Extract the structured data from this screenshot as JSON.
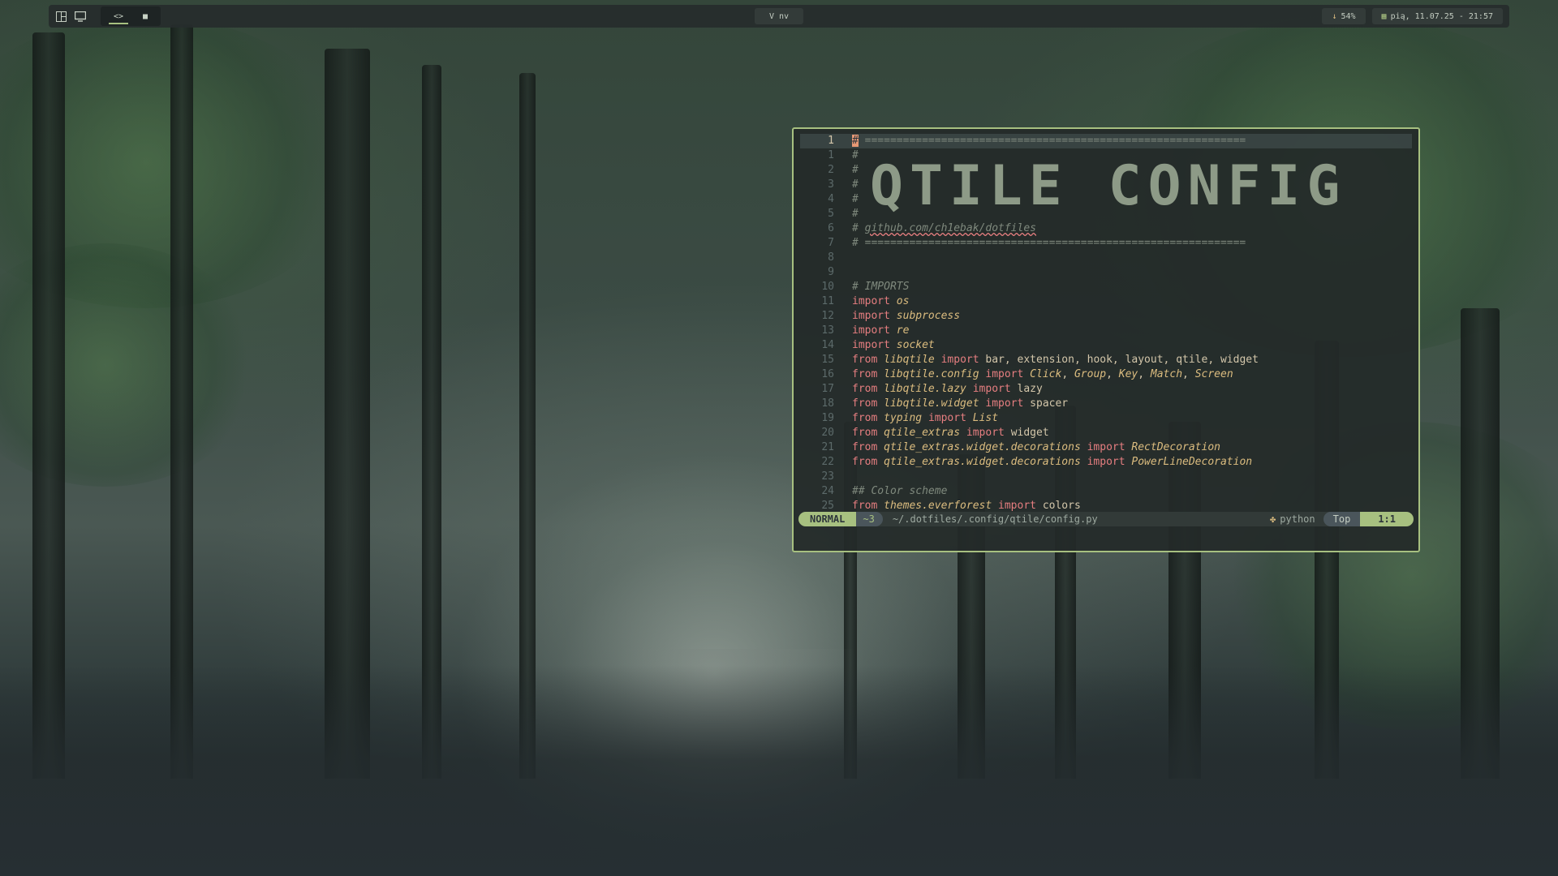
{
  "topbar": {
    "left_icons": [
      "layout-icon",
      "monitor-icon"
    ],
    "workspaces": [
      {
        "label": "<>",
        "icon": "code-icon",
        "active": true
      },
      {
        "label": "■",
        "icon": "camera-icon",
        "active": false
      }
    ],
    "window_name": "V nv",
    "battery": {
      "icon": "arrow-down-icon",
      "value": "54%"
    },
    "clock": {
      "icon": "calendar-icon",
      "value": "pią, 11.07.25 - 21:57"
    }
  },
  "editor": {
    "lines": [
      {
        "n": "1",
        "cur": true,
        "text": "# ============================================================"
      },
      {
        "n": "1",
        "text": "#"
      },
      {
        "n": "2",
        "text": "#"
      },
      {
        "n": "3",
        "text": "#"
      },
      {
        "n": "4",
        "text": "#"
      },
      {
        "n": "5",
        "text": "#"
      },
      {
        "n": "6",
        "text": "# github.com/ch1ebak/dotfiles"
      },
      {
        "n": "7",
        "text": "# ============================================================"
      },
      {
        "n": "8",
        "text": ""
      },
      {
        "n": "9",
        "text": ""
      },
      {
        "n": "10",
        "text": "# IMPORTS"
      },
      {
        "n": "11",
        "text": "import os"
      },
      {
        "n": "12",
        "text": "import subprocess"
      },
      {
        "n": "13",
        "text": "import re"
      },
      {
        "n": "14",
        "text": "import socket"
      },
      {
        "n": "15",
        "text": "from libqtile import bar, extension, hook, layout, qtile, widget"
      },
      {
        "n": "16",
        "text": "from libqtile.config import Click, Group, Key, Match, Screen"
      },
      {
        "n": "17",
        "text": "from libqtile.lazy import lazy"
      },
      {
        "n": "18",
        "text": "from libqtile.widget import spacer"
      },
      {
        "n": "19",
        "text": "from typing import List"
      },
      {
        "n": "20",
        "text": "from qtile_extras import widget"
      },
      {
        "n": "21",
        "text": "from qtile_extras.widget.decorations import RectDecoration"
      },
      {
        "n": "22",
        "text": "from qtile_extras.widget.decorations import PowerLineDecoration"
      },
      {
        "n": "23",
        "text": ""
      },
      {
        "n": "24",
        "text": "## Color scheme"
      },
      {
        "n": "25",
        "text": "from themes.everforest import colors"
      }
    ],
    "banner": "QTILE CONFIG"
  },
  "statusline": {
    "mode": "NORMAL",
    "branch": "~3",
    "path": "~/.dotfiles/.config/qtile/config.py",
    "filetype": "python",
    "position": "Top",
    "cursor": "1:1"
  },
  "colors": {
    "accent": "#a7c080",
    "keyword": "#e67e80",
    "module": "#dbbc7f",
    "comment": "#7f897d",
    "text": "#d3c6aa"
  }
}
